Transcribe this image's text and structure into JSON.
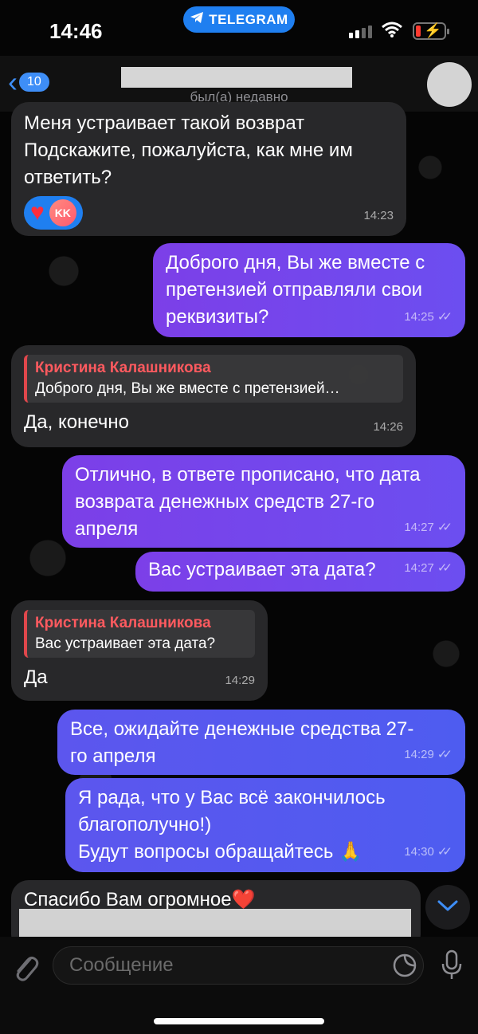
{
  "status_bar": {
    "time": "14:46",
    "app_pill": "TELEGRAM"
  },
  "header": {
    "back_count": "10",
    "last_seen": "был(а) недавно"
  },
  "messages": [
    {
      "lines": [
        "Меня устраивает такой возврат",
        "Подскажите, пожалуйста, как мне им",
        "ответить?"
      ],
      "time": "14:23",
      "reaction_initials": "KK"
    },
    {
      "lines": [
        "Доброго дня, Вы же вместе с",
        "претензией отправляли свои",
        "реквизиты?"
      ],
      "time": "14:25"
    },
    {
      "reply_name": "Кристина Калашникова",
      "reply_text": "Доброго дня, Вы же вместе с претензией…",
      "text": "Да, конечно",
      "time": "14:26"
    },
    {
      "lines": [
        "Отлично, в ответе прописано, что дата",
        "возврата денежных средств 27-го",
        "апреля"
      ],
      "time": "14:27"
    },
    {
      "text": "Вас устраивает эта дата?",
      "time": "14:27"
    },
    {
      "reply_name": "Кристина Калашникова",
      "reply_text": "Вас устраивает эта дата?",
      "text": "Да",
      "time": "14:29"
    },
    {
      "lines": [
        "Все, ожидайте денежные средства 27-",
        "го апреля"
      ],
      "time": "14:29"
    },
    {
      "lines": [
        "Я рада, что у Вас всё закончилось",
        "благополучно!)",
        "Будут вопросы обращайтесь 🙏"
      ],
      "time": "14:30"
    },
    {
      "text": "Спасибо Вам огромное❤️"
    }
  ],
  "input": {
    "placeholder": "Сообщение"
  },
  "colors": {
    "accent": "#3e8ef7",
    "outgoing_purple": "#7c3fe8",
    "outgoing_blue": "#5c56ee",
    "incoming": "#2a2a2c"
  }
}
